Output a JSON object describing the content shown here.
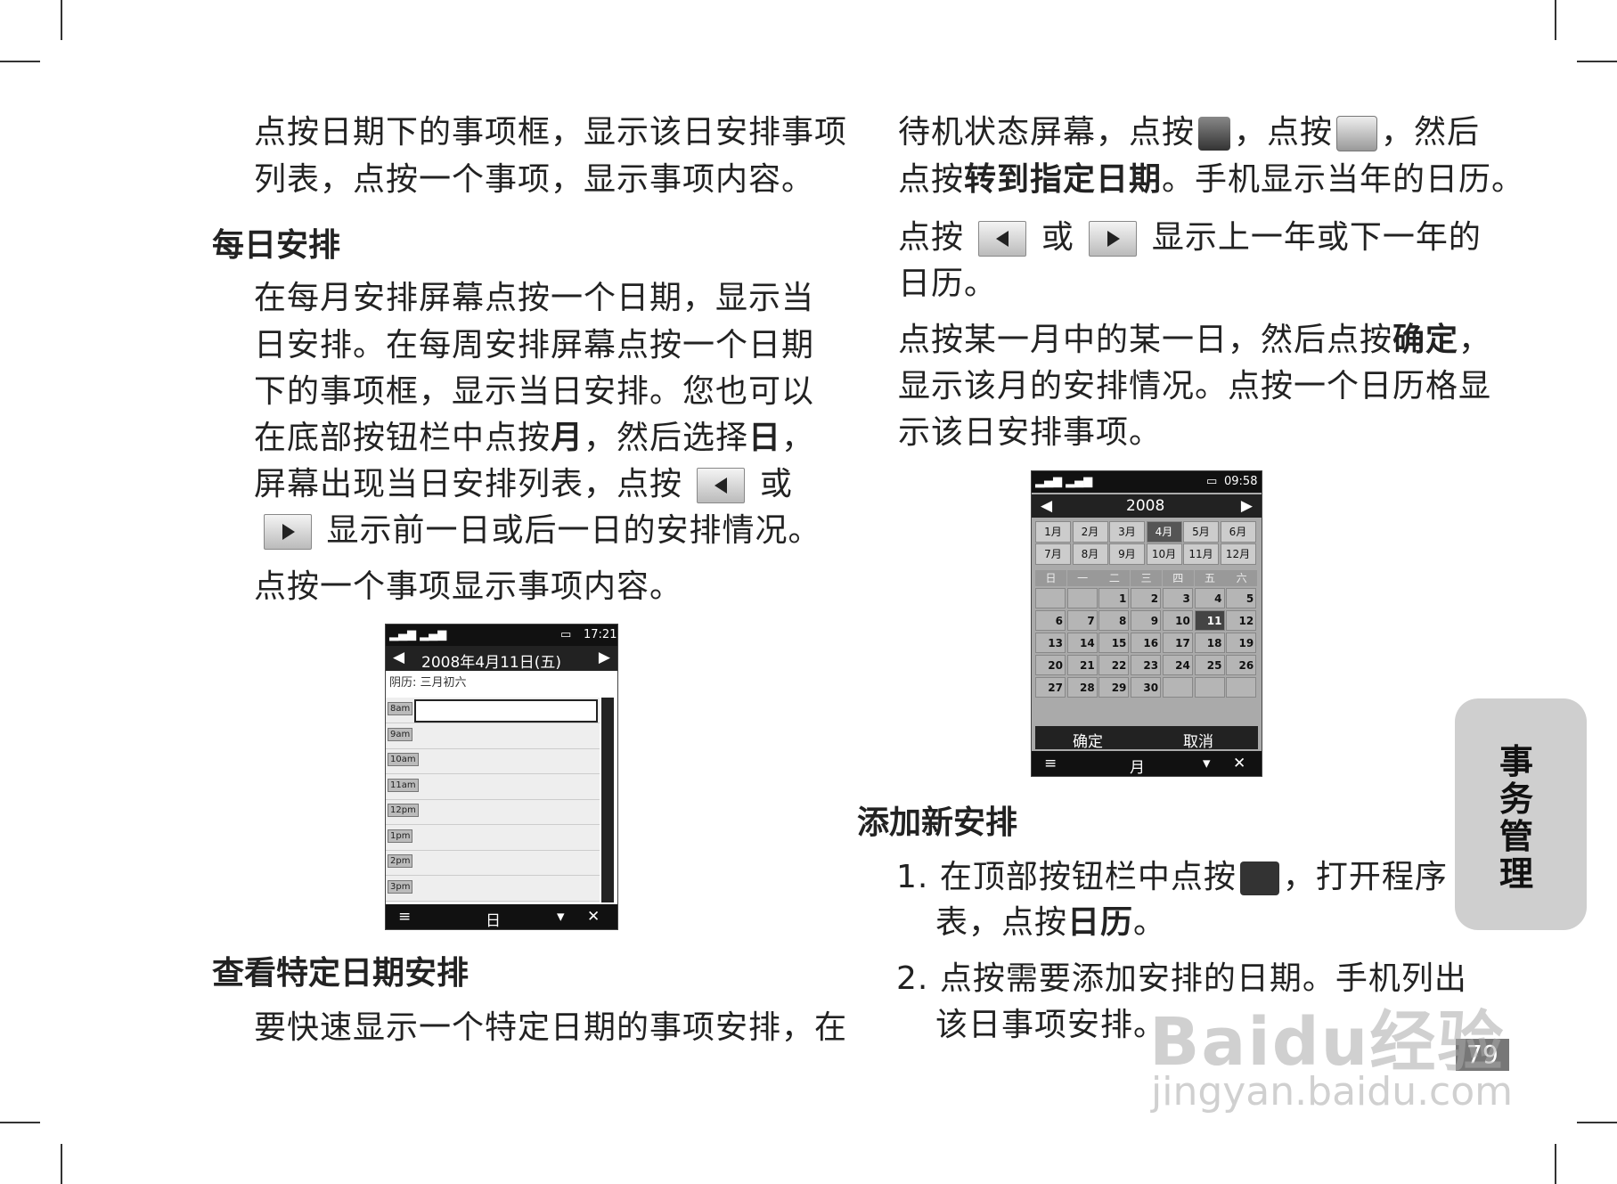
{
  "left": {
    "p1_l1": "点按日期下的事项框，显示该日安排事项",
    "p1_l2": "列表，点按一个事项，显示事项内容。",
    "h_daily": "每日安排",
    "d_l1": "在每月安排屏幕点按一个日期，显示当",
    "d_l2": "日安排。在每周安排屏幕点按一个日期",
    "d_l3": "下的事项框，显示当日安排。您也可以",
    "d_l4a": "在底部按钮栏中点按",
    "d_l4b": "月",
    "d_l4c": "，然后选择",
    "d_l4d": "日",
    "d_l4e": "，",
    "d_l5a": "屏幕出现当日安排列表，点按",
    "d_l5b": "或",
    "d_l6": "显示前一日或后一日的安排情况。",
    "d_l7": "点按一个事项显示事项内容。",
    "h_specific": "查看特定日期安排",
    "s_l1": "要快速显示一个特定日期的事项安排，在"
  },
  "right": {
    "r_l1a": "待机状态屏幕，点按",
    "r_l1b": "，点按",
    "r_l1c": "，然后",
    "r_l2a": "点按",
    "r_l2b": "转到指定日期",
    "r_l2c": "。手机显示当年的日历。",
    "r_l3a": "点按",
    "r_l3b": "或",
    "r_l3c": "显示上一年或下一年的",
    "r_l4": "日历。",
    "r_l5a": "点按某一月中的某一日，然后点按",
    "r_l5b": "确定",
    "r_l5c": "，",
    "r_l6": "显示该月的安排情况。点按一个日历格显",
    "r_l7": "示该日安排事项。",
    "h_add": "添加新安排",
    "a1_num": "1.",
    "a1_l1a": "在顶部按钮栏中点按",
    "a1_l1b": "，打开程序",
    "a1_l2a": "表，点按",
    "a1_l2b": "日历",
    "a1_l2c": "。",
    "a2_num": "2.",
    "a2_l1": "点按需要添加安排的日期。手机列出",
    "a2_l2": "该日事项安排。"
  },
  "side_tab": [
    "事",
    "务",
    "管",
    "理"
  ],
  "page_number": "79",
  "watermark": {
    "brand": "Baidu经验",
    "url": "jingyan.baidu.com"
  },
  "phone_day": {
    "time": "17:21",
    "date_title": "2008年4月11日(五)",
    "lunar": "阴历: 三月初六",
    "hours": [
      "8am",
      "9am",
      "10am",
      "11am",
      "12pm",
      "1pm",
      "2pm",
      "3pm"
    ],
    "bottom_label": "日"
  },
  "phone_cal": {
    "time": "09:58",
    "year": "2008",
    "months": [
      "1月",
      "2月",
      "3月",
      "4月",
      "5月",
      "6月",
      "7月",
      "8月",
      "9月",
      "10月",
      "11月",
      "12月"
    ],
    "selected_month": "4月",
    "weekdays": [
      "日",
      "一",
      "二",
      "三",
      "四",
      "五",
      "六"
    ],
    "weeks": [
      [
        "",
        "",
        "1",
        "2",
        "3",
        "4",
        "5"
      ],
      [
        "6",
        "7",
        "8",
        "9",
        "10",
        "11",
        "12"
      ],
      [
        "13",
        "14",
        "15",
        "16",
        "17",
        "18",
        "19"
      ],
      [
        "20",
        "21",
        "22",
        "23",
        "24",
        "25",
        "26"
      ],
      [
        "27",
        "28",
        "29",
        "30",
        "",
        "",
        ""
      ]
    ],
    "selected_day": "11",
    "ok_label": "确定",
    "cancel_label": "取消",
    "bottom_label": "月"
  }
}
